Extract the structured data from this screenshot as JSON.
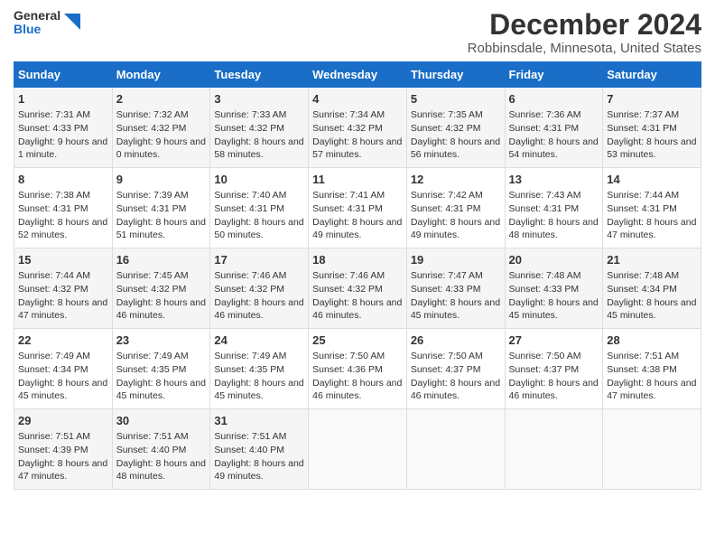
{
  "header": {
    "logo_general": "General",
    "logo_blue": "Blue",
    "month": "December 2024",
    "location": "Robbinsdale, Minnesota, United States"
  },
  "days_of_week": [
    "Sunday",
    "Monday",
    "Tuesday",
    "Wednesday",
    "Thursday",
    "Friday",
    "Saturday"
  ],
  "weeks": [
    [
      {
        "day": "1",
        "sunrise": "7:31 AM",
        "sunset": "4:33 PM",
        "daylight": "9 hours and 1 minute."
      },
      {
        "day": "2",
        "sunrise": "7:32 AM",
        "sunset": "4:32 PM",
        "daylight": "9 hours and 0 minutes."
      },
      {
        "day": "3",
        "sunrise": "7:33 AM",
        "sunset": "4:32 PM",
        "daylight": "8 hours and 58 minutes."
      },
      {
        "day": "4",
        "sunrise": "7:34 AM",
        "sunset": "4:32 PM",
        "daylight": "8 hours and 57 minutes."
      },
      {
        "day": "5",
        "sunrise": "7:35 AM",
        "sunset": "4:32 PM",
        "daylight": "8 hours and 56 minutes."
      },
      {
        "day": "6",
        "sunrise": "7:36 AM",
        "sunset": "4:31 PM",
        "daylight": "8 hours and 54 minutes."
      },
      {
        "day": "7",
        "sunrise": "7:37 AM",
        "sunset": "4:31 PM",
        "daylight": "8 hours and 53 minutes."
      }
    ],
    [
      {
        "day": "8",
        "sunrise": "7:38 AM",
        "sunset": "4:31 PM",
        "daylight": "8 hours and 52 minutes."
      },
      {
        "day": "9",
        "sunrise": "7:39 AM",
        "sunset": "4:31 PM",
        "daylight": "8 hours and 51 minutes."
      },
      {
        "day": "10",
        "sunrise": "7:40 AM",
        "sunset": "4:31 PM",
        "daylight": "8 hours and 50 minutes."
      },
      {
        "day": "11",
        "sunrise": "7:41 AM",
        "sunset": "4:31 PM",
        "daylight": "8 hours and 49 minutes."
      },
      {
        "day": "12",
        "sunrise": "7:42 AM",
        "sunset": "4:31 PM",
        "daylight": "8 hours and 49 minutes."
      },
      {
        "day": "13",
        "sunrise": "7:43 AM",
        "sunset": "4:31 PM",
        "daylight": "8 hours and 48 minutes."
      },
      {
        "day": "14",
        "sunrise": "7:44 AM",
        "sunset": "4:31 PM",
        "daylight": "8 hours and 47 minutes."
      }
    ],
    [
      {
        "day": "15",
        "sunrise": "7:44 AM",
        "sunset": "4:32 PM",
        "daylight": "8 hours and 47 minutes."
      },
      {
        "day": "16",
        "sunrise": "7:45 AM",
        "sunset": "4:32 PM",
        "daylight": "8 hours and 46 minutes."
      },
      {
        "day": "17",
        "sunrise": "7:46 AM",
        "sunset": "4:32 PM",
        "daylight": "8 hours and 46 minutes."
      },
      {
        "day": "18",
        "sunrise": "7:46 AM",
        "sunset": "4:32 PM",
        "daylight": "8 hours and 46 minutes."
      },
      {
        "day": "19",
        "sunrise": "7:47 AM",
        "sunset": "4:33 PM",
        "daylight": "8 hours and 45 minutes."
      },
      {
        "day": "20",
        "sunrise": "7:48 AM",
        "sunset": "4:33 PM",
        "daylight": "8 hours and 45 minutes."
      },
      {
        "day": "21",
        "sunrise": "7:48 AM",
        "sunset": "4:34 PM",
        "daylight": "8 hours and 45 minutes."
      }
    ],
    [
      {
        "day": "22",
        "sunrise": "7:49 AM",
        "sunset": "4:34 PM",
        "daylight": "8 hours and 45 minutes."
      },
      {
        "day": "23",
        "sunrise": "7:49 AM",
        "sunset": "4:35 PM",
        "daylight": "8 hours and 45 minutes."
      },
      {
        "day": "24",
        "sunrise": "7:49 AM",
        "sunset": "4:35 PM",
        "daylight": "8 hours and 45 minutes."
      },
      {
        "day": "25",
        "sunrise": "7:50 AM",
        "sunset": "4:36 PM",
        "daylight": "8 hours and 46 minutes."
      },
      {
        "day": "26",
        "sunrise": "7:50 AM",
        "sunset": "4:37 PM",
        "daylight": "8 hours and 46 minutes."
      },
      {
        "day": "27",
        "sunrise": "7:50 AM",
        "sunset": "4:37 PM",
        "daylight": "8 hours and 46 minutes."
      },
      {
        "day": "28",
        "sunrise": "7:51 AM",
        "sunset": "4:38 PM",
        "daylight": "8 hours and 47 minutes."
      }
    ],
    [
      {
        "day": "29",
        "sunrise": "7:51 AM",
        "sunset": "4:39 PM",
        "daylight": "8 hours and 47 minutes."
      },
      {
        "day": "30",
        "sunrise": "7:51 AM",
        "sunset": "4:40 PM",
        "daylight": "8 hours and 48 minutes."
      },
      {
        "day": "31",
        "sunrise": "7:51 AM",
        "sunset": "4:40 PM",
        "daylight": "8 hours and 49 minutes."
      },
      null,
      null,
      null,
      null
    ]
  ]
}
